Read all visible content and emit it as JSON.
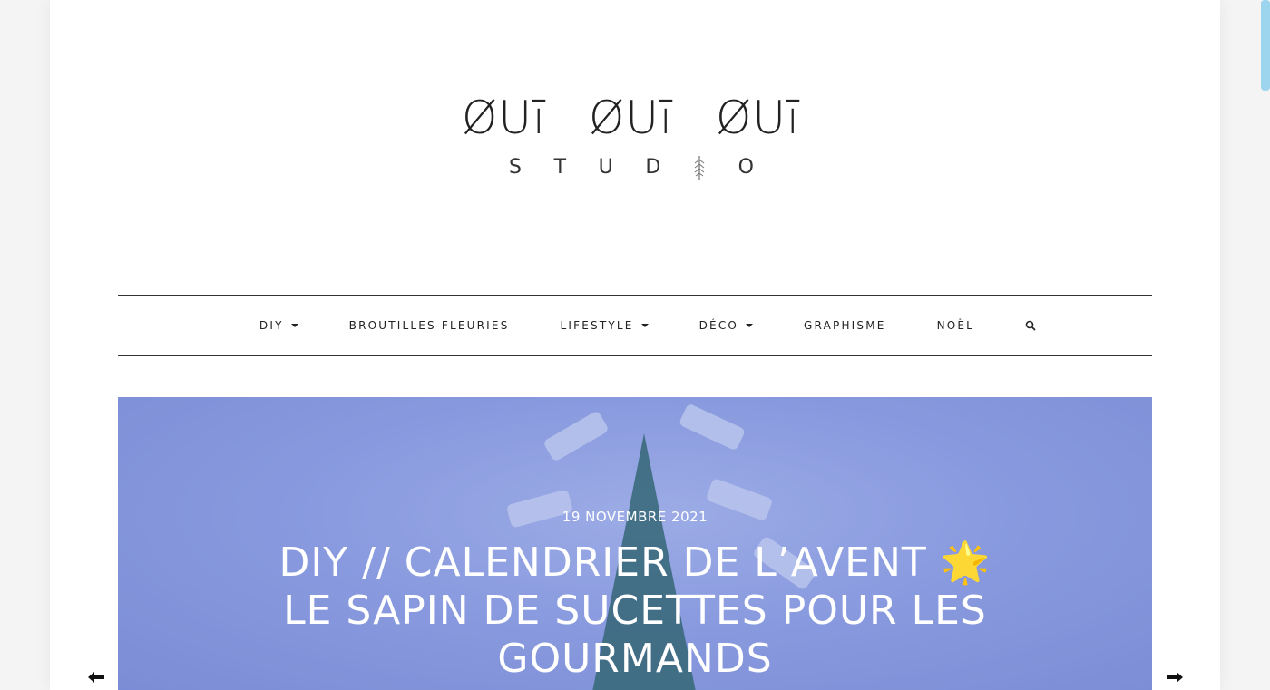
{
  "logo": {
    "line1": [
      "ØUī",
      "ØUī",
      "ØUī"
    ],
    "line2": [
      "S",
      "T",
      "U",
      "D",
      "O"
    ]
  },
  "nav": {
    "items": [
      {
        "label": "DIY",
        "dropdown": true
      },
      {
        "label": "BROUTILLES FLEURIES",
        "dropdown": false
      },
      {
        "label": "LIFESTYLE",
        "dropdown": true
      },
      {
        "label": "DÉCO",
        "dropdown": true
      },
      {
        "label": "GRAPHISME",
        "dropdown": false
      },
      {
        "label": "NOËL",
        "dropdown": false
      }
    ],
    "search_icon": "search-icon"
  },
  "hero": {
    "date": "19 NOVEMBRE 2021",
    "title_line1": "DIY // CALENDRIER DE L’AVENT 🌟",
    "title_line2": "LE SAPIN DE SUCETTES POUR LES",
    "title_line3": "GOURMANDS"
  },
  "arrows": {
    "prev": "arrow-left-icon",
    "next": "arrow-right-icon"
  },
  "colors": {
    "background": "#f4f4f4",
    "page": "#ffffff",
    "text": "#222222",
    "hero_blue": "#8f9fe0",
    "scrollbar": "#9dd4ee"
  }
}
